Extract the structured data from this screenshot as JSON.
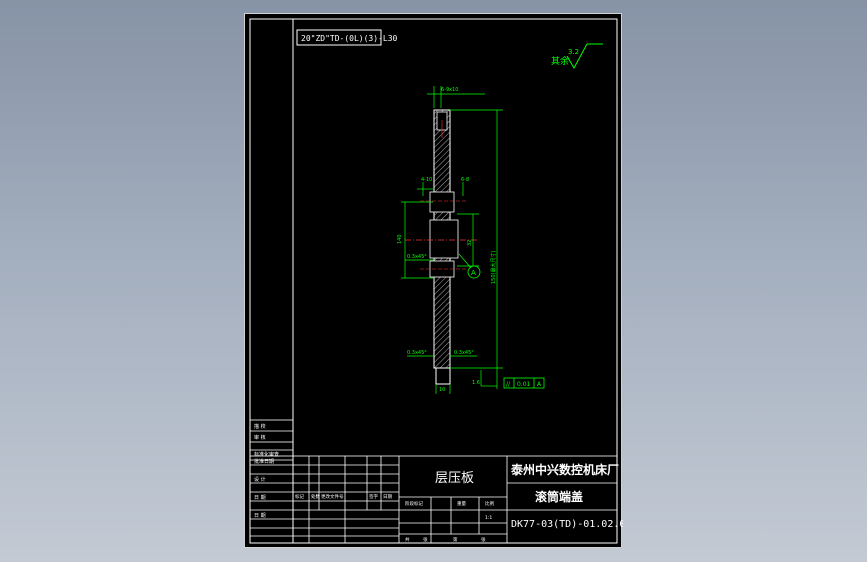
{
  "drawing": {
    "code_box": "20\"ZD\"TD-(0L)(3)-L30",
    "roughness_label": "其余",
    "roughness_value": "3.2"
  },
  "part": {
    "dimensions": {
      "top_flat": "6-9x10",
      "left_upper_a": "4-10",
      "left_upper_b": "6-8",
      "left_big": "140",
      "left_lower": "0.3x45°",
      "right_total": "150(最大尺寸)",
      "right_inner": "32",
      "bottom_left": "0.3x45°",
      "bottom_right": "0.3x45°",
      "bottom_width": "10",
      "bottom_right_small": "1.6"
    },
    "datum_label": "A",
    "tolerance": {
      "symbol": "//",
      "value": "0.01",
      "datum": "A"
    }
  },
  "title_block": {
    "left_rows": [
      "描 校",
      "审 核",
      "标准化审查",
      "批准日期",
      "设 计",
      "日 期",
      "日 期"
    ],
    "material": "层压板",
    "company": "泰州中兴数控机床厂",
    "part_name": "滚筒端盖",
    "drawing_no": "DK77-03(TD)-01.02.02",
    "headers": [
      "标记",
      "处数",
      "更改文件号",
      "签字",
      "日期"
    ],
    "stage_headers": [
      "阶段标记",
      "重量",
      "比例"
    ],
    "scale": "1:1",
    "sheet_info": [
      "共",
      "张",
      "第",
      "张"
    ]
  }
}
